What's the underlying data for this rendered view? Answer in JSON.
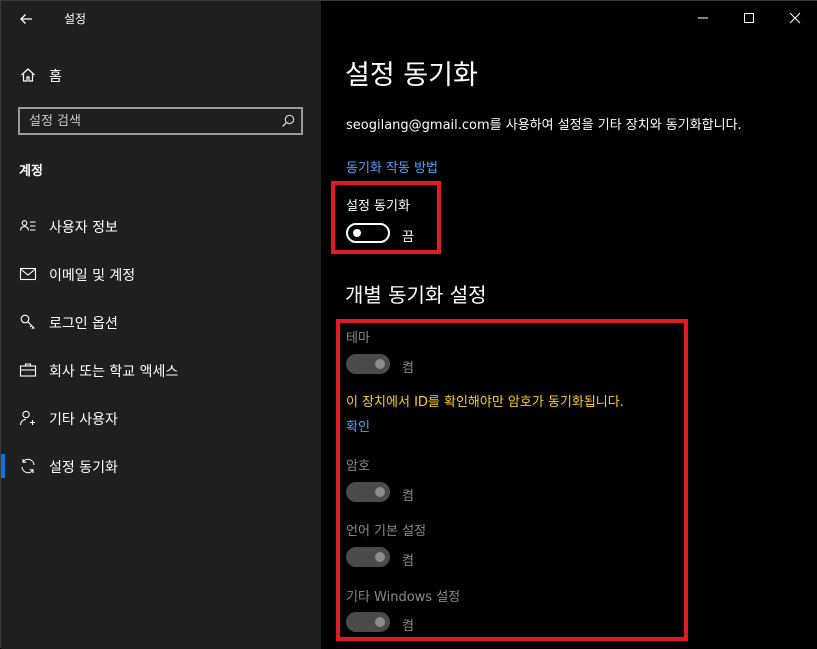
{
  "window": {
    "title": "설정"
  },
  "sidebar": {
    "home_label": "홈",
    "search_placeholder": "설정 검색",
    "section_title": "계정",
    "items": [
      {
        "label": "사용자 정보",
        "icon": "user-card-icon"
      },
      {
        "label": "이메일 및 계정",
        "icon": "mail-icon"
      },
      {
        "label": "로그인 옵션",
        "icon": "key-icon"
      },
      {
        "label": "회사 또는 학교 액세스",
        "icon": "briefcase-icon"
      },
      {
        "label": "기타 사용자",
        "icon": "person-add-icon"
      },
      {
        "label": "설정 동기화",
        "icon": "sync-icon",
        "active": true
      }
    ]
  },
  "main": {
    "title": "설정 동기화",
    "description": "seogilang@gmail.com를 사용하여 설정을 기타 장치와 동기화합니다.",
    "how_link": "동기화 작동 방법",
    "sync_setting": {
      "label": "설정 동기화",
      "state": "끔",
      "on": false
    },
    "individual_heading": "개별 동기화 설정",
    "theme": {
      "label": "테마",
      "state": "켬",
      "on": true,
      "disabled": true
    },
    "warning_text": "이 장치에서 ID를 확인해야만 암호가 동기화됩니다.",
    "verify_link": "확인",
    "password": {
      "label": "암호",
      "state": "켬",
      "on": true,
      "disabled": true
    },
    "language": {
      "label": "언어 기본 설정",
      "state": "켬",
      "on": true,
      "disabled": true
    },
    "other_windows": {
      "label": "기타 Windows 설정",
      "state": "켬",
      "on": true,
      "disabled": true
    }
  },
  "colors": {
    "accent": "#0a74da",
    "link": "#4fa3ff",
    "warning": "#ffd10a",
    "highlight": "#e11b22"
  }
}
